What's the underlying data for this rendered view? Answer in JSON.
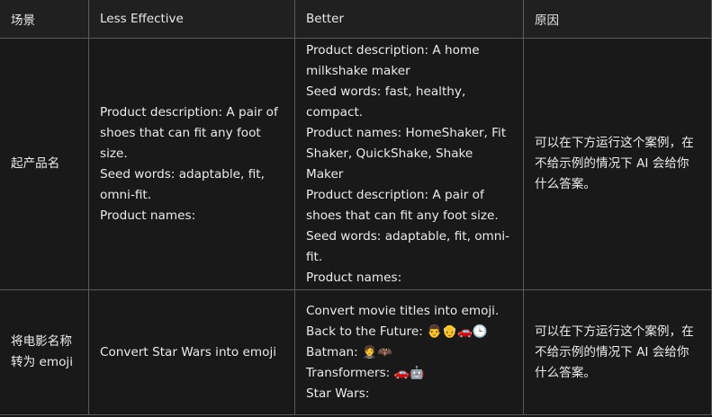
{
  "headers": [
    "场景",
    "Less Effective",
    "Better",
    "原因"
  ],
  "rows": [
    {
      "scenario": "起产品名",
      "less_effective": [
        "Product description: A pair of shoes that can fit any foot size.",
        "Seed words: adaptable, fit, omni-fit.",
        "Product names:"
      ],
      "better": [
        "Product description: A home milkshake maker",
        "Seed words: fast, healthy, compact.",
        "Product names: HomeShaker, Fit Shaker, QuickShake, Shake Maker",
        "Product description: A pair of shoes that can fit any foot size.",
        "Seed words: adaptable, fit, omni-fit.",
        "Product names:"
      ],
      "reason": "可以在下方运行这个案例，在不给示例的情况下 AI 会给你什么答案。"
    },
    {
      "scenario": "将电影名称转为 emoji",
      "less_effective": [
        "Convert Star Wars into emoji"
      ],
      "better": [
        "Convert movie titles into emoji.",
        "Back to the Future: 👨👴🚗🕒",
        "Batman: 🤵🦇",
        "Transformers: 🚗🤖",
        "Star Wars:"
      ],
      "reason": "可以在下方运行这个案例，在不给示例的情况下 AI 会给你什么答案。"
    }
  ]
}
